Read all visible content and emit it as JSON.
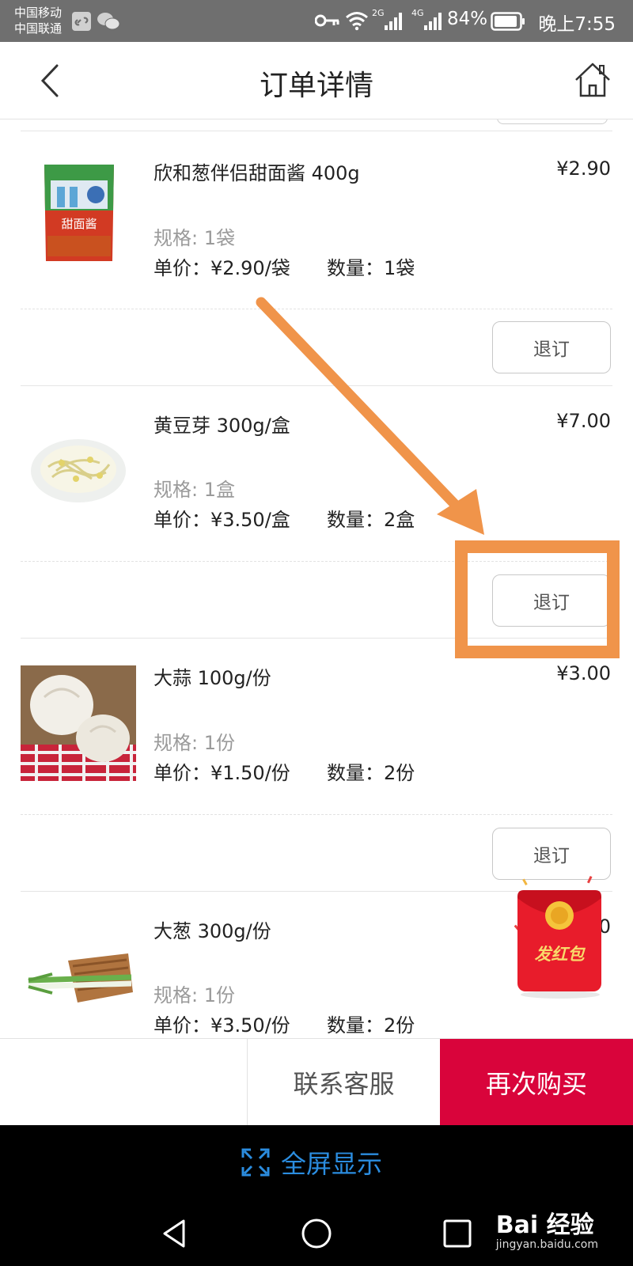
{
  "status_bar": {
    "carrier_1": "中国移动",
    "carrier_2": "中国联通",
    "network_2g": "2G",
    "network_4g": "4G",
    "battery": "84%",
    "time": "晚上7:55"
  },
  "header": {
    "title": "订单详情"
  },
  "items": [
    {
      "name": "欣和葱伴侣甜面酱 400g",
      "price": "¥2.90",
      "spec": "规格: 1袋",
      "unit_price": "单价：¥2.90/袋",
      "quantity": "数量：1袋",
      "image_text": "甜面酱",
      "refund_label": "退订"
    },
    {
      "name": "黄豆芽 300g/盒",
      "price": "¥7.00",
      "spec": "规格: 1盒",
      "unit_price": "单价：¥3.50/盒",
      "quantity": "数量：2盒",
      "refund_label": "退订"
    },
    {
      "name": "大蒜 100g/份",
      "price": "¥3.00",
      "spec": "规格: 1份",
      "unit_price": "单价：¥1.50/份",
      "quantity": "数量：2份",
      "refund_label": "退订"
    },
    {
      "name": "大葱 300g/份",
      "price": "0",
      "spec": "规格: 1份",
      "unit_price": "单价：¥3.50/份",
      "quantity": "数量：2份"
    }
  ],
  "red_packet": {
    "label": "发红包"
  },
  "bottom_bar": {
    "contact_label": "联系客服",
    "rebuy_label": "再次购买"
  },
  "fullscreen": {
    "label": "全屏显示"
  },
  "watermark": {
    "logo": "Bai 经验",
    "url": "jingyan.baidu.com"
  },
  "colors": {
    "accent_red": "#d9043b",
    "annotation_orange": "#f0944a",
    "fullscreen_blue": "#2b8de0"
  }
}
